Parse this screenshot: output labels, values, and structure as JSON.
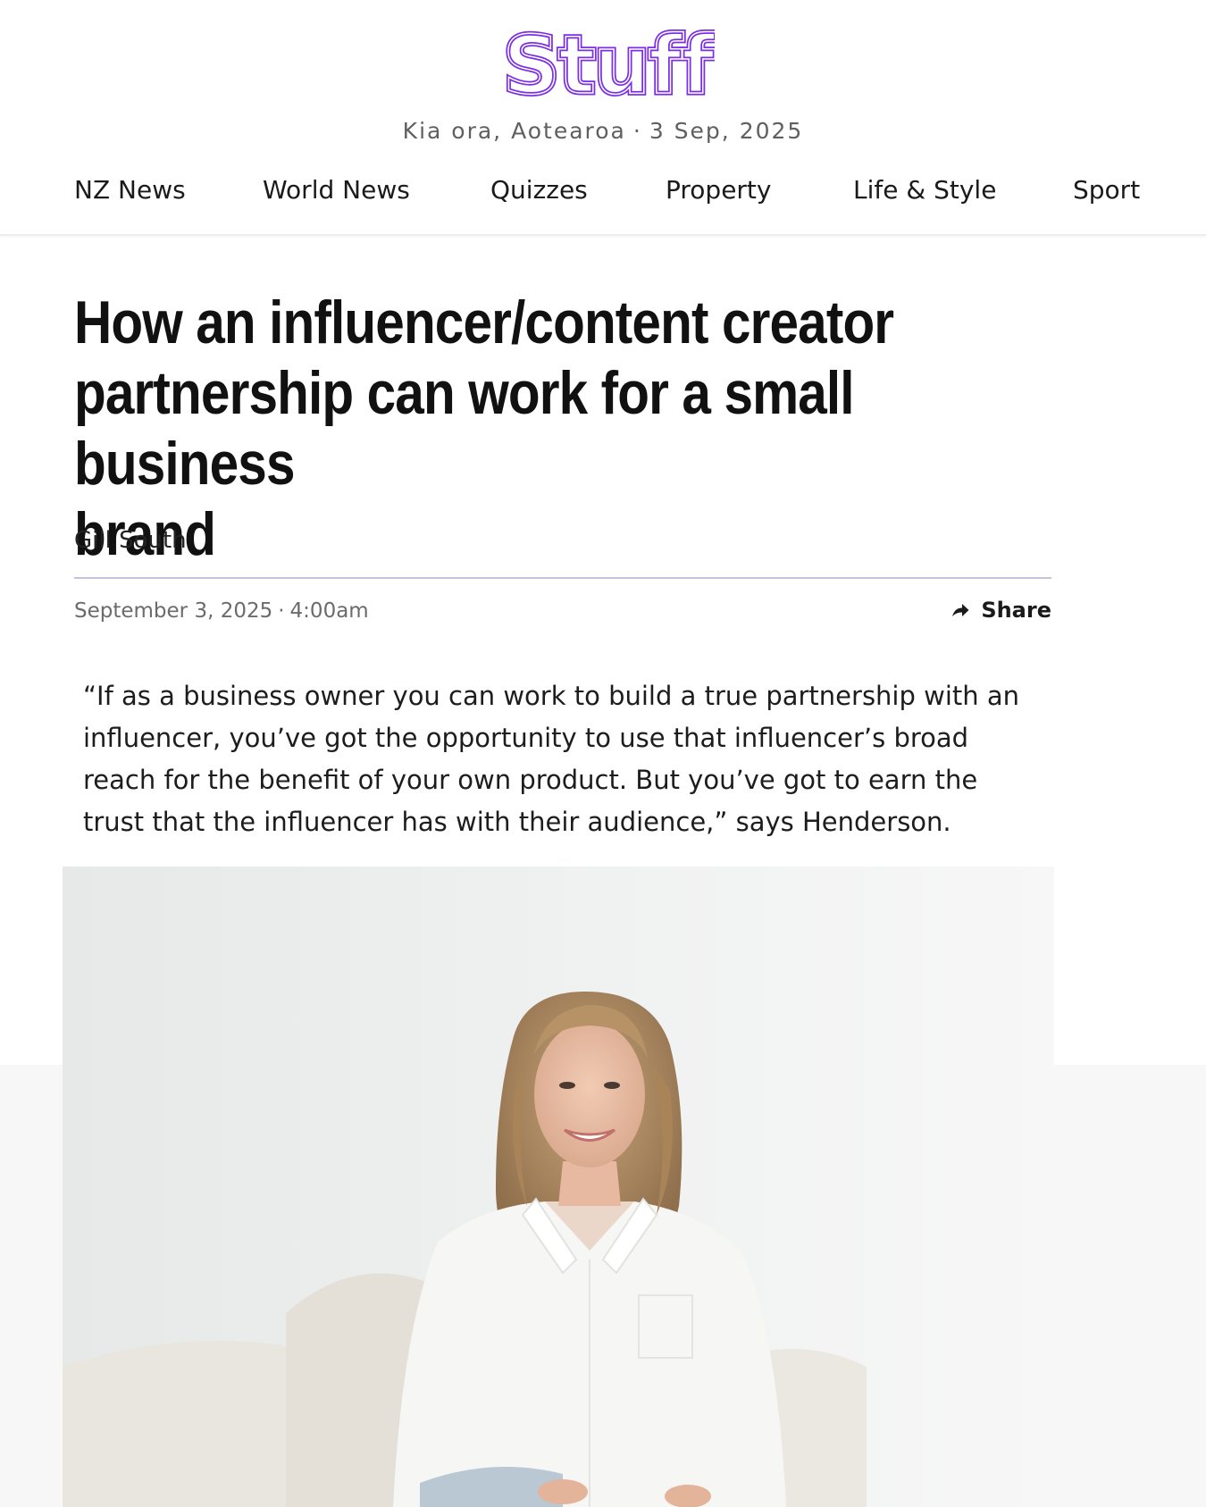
{
  "brand": {
    "logo_text": "Stuff",
    "accent_color": "#7a2ee6"
  },
  "header": {
    "greeting": "Kia ora, Aotearoa",
    "date": "3 Sep, 2025",
    "separator": "·"
  },
  "nav": {
    "items": [
      {
        "label": "NZ News"
      },
      {
        "label": "World News"
      },
      {
        "label": "Quizzes"
      },
      {
        "label": "Property"
      },
      {
        "label": "Life & Style"
      },
      {
        "label": "Sport"
      }
    ]
  },
  "article": {
    "headline_lines": [
      "How an influencer/content creator",
      "partnership can work for a small business",
      "brand"
    ],
    "author": "Gill South",
    "published_date": "September 3, 2025",
    "published_time": "4:00am",
    "meta_separator": "·",
    "share_label": "Share",
    "share_icon": "share-arrow-icon",
    "quote_lines": [
      "“If as a business owner you can work to build a true partnership with an",
      "influencer, you’ve got the opportunity to use that influencer’s broad",
      "reach for the benefit of your own product. But you’ve got to earn the",
      "trust that the influencer has with their audience,” says Henderson."
    ]
  }
}
